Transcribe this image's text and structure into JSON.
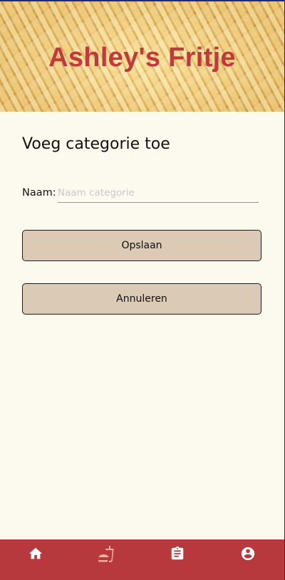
{
  "header": {
    "title": "Ashley's Fritje"
  },
  "page": {
    "heading": "Voeg categorie toe"
  },
  "form": {
    "name_label": "Naam:",
    "name_value": "",
    "name_placeholder": "Naam categorie"
  },
  "buttons": {
    "save_label": "Opslaan",
    "cancel_label": "Annuleren"
  },
  "nav": {
    "items": [
      {
        "icon": "home-icon",
        "active": false
      },
      {
        "icon": "fastfood-icon",
        "active": true
      },
      {
        "icon": "clipboard-icon",
        "active": false
      },
      {
        "icon": "account-icon",
        "active": false
      }
    ]
  },
  "colors": {
    "brand_red": "#b7383d",
    "title_red": "#c0393c",
    "background": "#fcf9ee",
    "button": "#dbcab5"
  }
}
